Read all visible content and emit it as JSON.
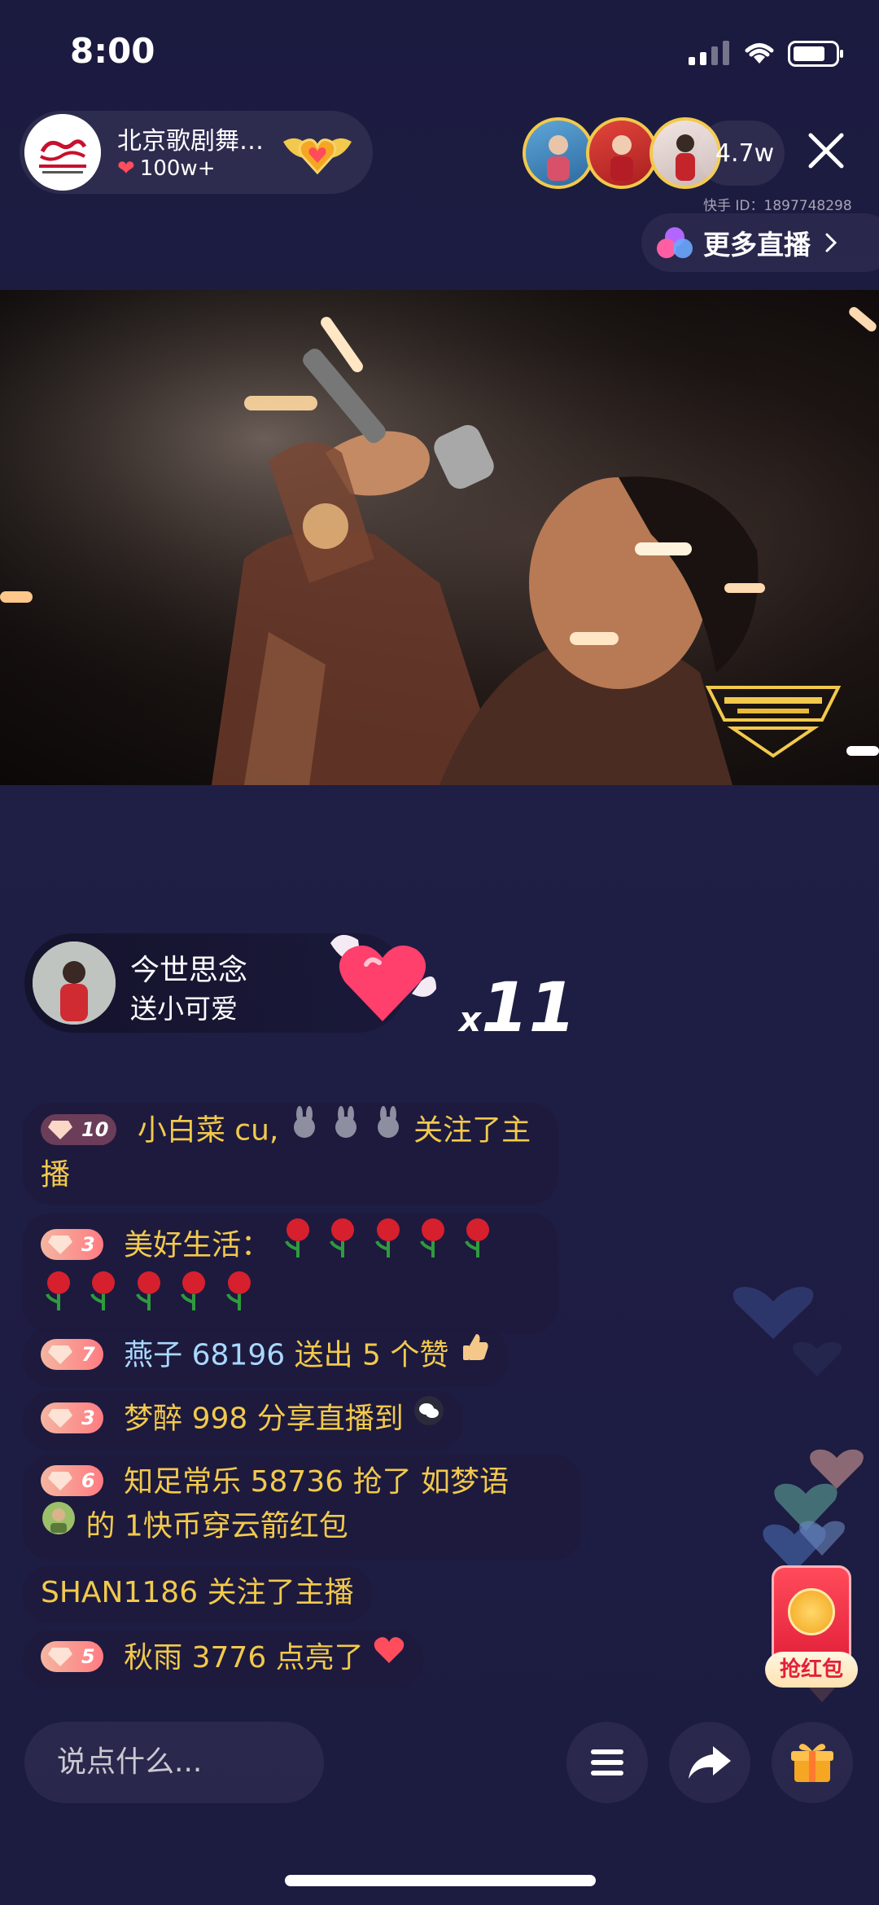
{
  "status_bar": {
    "time": "8:00"
  },
  "streamer": {
    "name": "北京歌剧舞…",
    "likes": "100w+"
  },
  "audience": {
    "count": "4.7w"
  },
  "kuaishou_id": "快手 ID：1897748298",
  "more_live": {
    "label": "更多直播"
  },
  "gift_banner": {
    "sender": "今世思念",
    "action": "送小可爱",
    "count_prefix": "x",
    "count": "11"
  },
  "comments": [
    {
      "level": "10",
      "user": "小白菜 cu,",
      "text": "关注了主播"
    },
    {
      "level": "3",
      "user": "美好生活：",
      "text": ""
    },
    {
      "level": "7",
      "user": "燕子 68196",
      "text": "送出 5 个赞"
    },
    {
      "level": "3",
      "user": "梦醉 998",
      "text": "分享直播到"
    },
    {
      "level": "6",
      "user": "知足常乐 58736",
      "text": "抢了 如梦语",
      "text2": "的 1快币穿云箭红包"
    },
    {
      "level": "",
      "user": "SHAN1186",
      "text": "关注了主播"
    },
    {
      "level": "5",
      "user": "秋雨 3776",
      "text": "点亮了"
    }
  ],
  "red_packet": {
    "label": "抢红包"
  },
  "bottom_bar": {
    "input_placeholder": "说点什么..."
  },
  "colors": {
    "background": "#1d1c42",
    "username": "#f2c94c",
    "accent_blue": "#a9d8ff",
    "badge": "#ff7b82"
  }
}
